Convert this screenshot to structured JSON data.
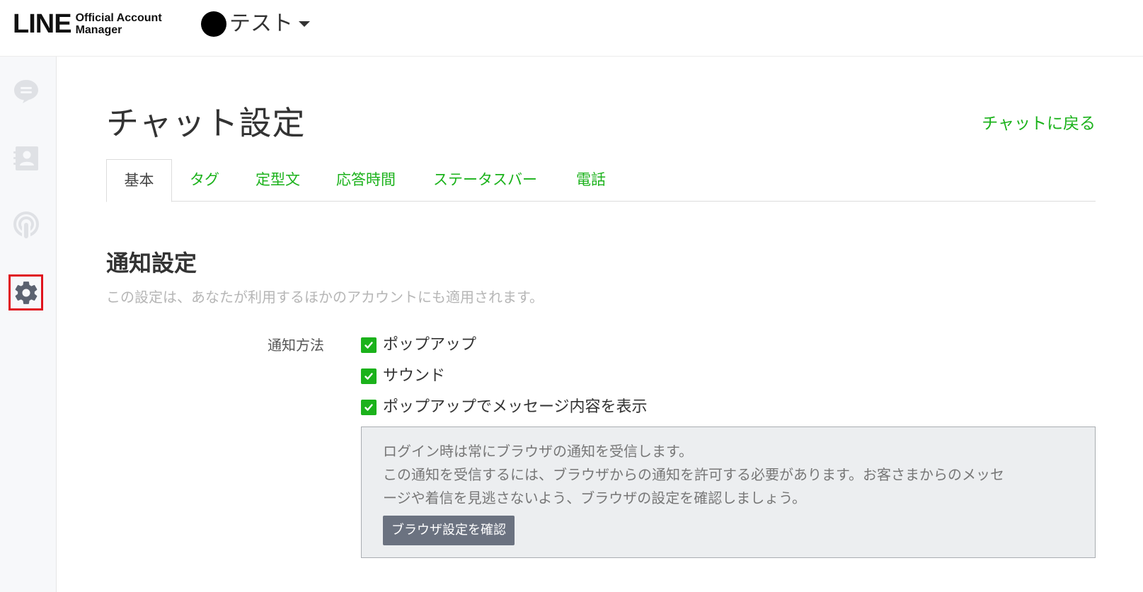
{
  "header": {
    "logo_main": "LINE",
    "logo_sub_1": "Official Account",
    "logo_sub_2": "Manager",
    "account_name": "テスト"
  },
  "sidebar": {
    "items": [
      {
        "name": "chat",
        "icon": "chat-bubble-icon"
      },
      {
        "name": "contacts",
        "icon": "contact-card-icon"
      },
      {
        "name": "broadcast",
        "icon": "broadcast-icon"
      },
      {
        "name": "settings",
        "icon": "gear-icon",
        "highlighted": true
      }
    ],
    "highlight_color": "#e0141e"
  },
  "page": {
    "title": "チャット設定",
    "back_link": "チャットに戻る"
  },
  "tabs": [
    {
      "label": "基本",
      "active": true
    },
    {
      "label": "タグ",
      "active": false
    },
    {
      "label": "定型文",
      "active": false
    },
    {
      "label": "応答時間",
      "active": false
    },
    {
      "label": "ステータスバー",
      "active": false
    },
    {
      "label": "電話",
      "active": false
    }
  ],
  "notification": {
    "section_title": "通知設定",
    "section_desc": "この設定は、あなたが利用するほかのアカウントにも適用されます。",
    "field_label": "通知方法",
    "options": [
      {
        "label": "ポップアップ",
        "checked": true
      },
      {
        "label": "サウンド",
        "checked": true
      },
      {
        "label": "ポップアップでメッセージ内容を表示",
        "checked": true
      }
    ],
    "info": {
      "line1": "ログイン時は常にブラウザの通知を受信します。",
      "line2": "この通知を受信するには、ブラウザからの通知を許可する必要があります。お客さまからのメッセ",
      "line3": "ージや着信を見逃さないよう、ブラウザの設定を確認しましょう。",
      "button_label": "ブラウザ設定を確認"
    }
  },
  "colors": {
    "accent_green": "#1bb21b",
    "checkbox_green": "#1bb21b",
    "button_gray": "#6b7280"
  }
}
